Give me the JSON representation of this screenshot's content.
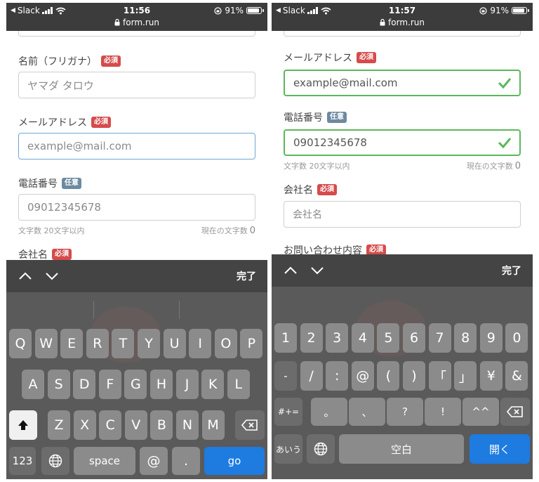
{
  "left": {
    "status": {
      "back_app": "Slack",
      "time": "11:56",
      "url": "form.run",
      "battery": "91%",
      "battery_level": 0.91
    },
    "form": {
      "name_kana": {
        "label": "名前（フリガナ）",
        "badge": "必須",
        "placeholder": "ヤマダ タロウ"
      },
      "email": {
        "label": "メールアドレス",
        "badge": "必須",
        "placeholder": "example@mail.com"
      },
      "phone": {
        "label": "電話番号",
        "badge": "任意",
        "placeholder": "09012345678",
        "hint": "文字数 20文字以内",
        "count_label": "現在の文字数",
        "count": "0"
      },
      "company": {
        "label": "会社名",
        "badge": "必須"
      }
    },
    "accessory": {
      "done": "完了"
    },
    "keyboard": {
      "row1": [
        "Q",
        "W",
        "E",
        "R",
        "T",
        "Y",
        "U",
        "I",
        "O",
        "P"
      ],
      "row2": [
        "A",
        "S",
        "D",
        "F",
        "G",
        "H",
        "J",
        "K",
        "L"
      ],
      "row3": [
        "Z",
        "X",
        "C",
        "V",
        "B",
        "N",
        "M"
      ],
      "num": "123",
      "space": "space",
      "at": "@",
      "dot": ".",
      "go": "go"
    }
  },
  "right": {
    "status": {
      "back_app": "Slack",
      "time": "11:57",
      "url": "form.run",
      "battery": "91%",
      "battery_level": 0.91
    },
    "form": {
      "email": {
        "label": "メールアドレス",
        "badge": "必須",
        "value": "example@mail.com"
      },
      "phone": {
        "label": "電話番号",
        "badge": "任意",
        "value": "09012345678",
        "hint": "文字数 20文字以内",
        "count_label": "現在の文字数",
        "count": "0"
      },
      "company": {
        "label": "会社名",
        "badge": "必須",
        "placeholder": "会社名"
      },
      "inquiry": {
        "label": "お問い合わせ内容",
        "badge": "必須"
      }
    },
    "accessory": {
      "done": "完了"
    },
    "keyboard": {
      "row1": [
        "1",
        "2",
        "3",
        "4",
        "5",
        "6",
        "7",
        "8",
        "9",
        "0"
      ],
      "row2": [
        "-",
        "/",
        ":",
        "@",
        "(",
        ")",
        "「",
        "」",
        "¥",
        "&"
      ],
      "row3": [
        "。",
        "、",
        "?",
        "!",
        "^^"
      ],
      "symbols": "#+=",
      "kana": "あいう",
      "space": "空白",
      "go": "開く"
    }
  },
  "colors": {
    "required": "#d54b4b",
    "optional": "#6c8aa0",
    "valid": "#5bb85b",
    "focus": "#6fa7d6",
    "go": "#1e7be0"
  }
}
